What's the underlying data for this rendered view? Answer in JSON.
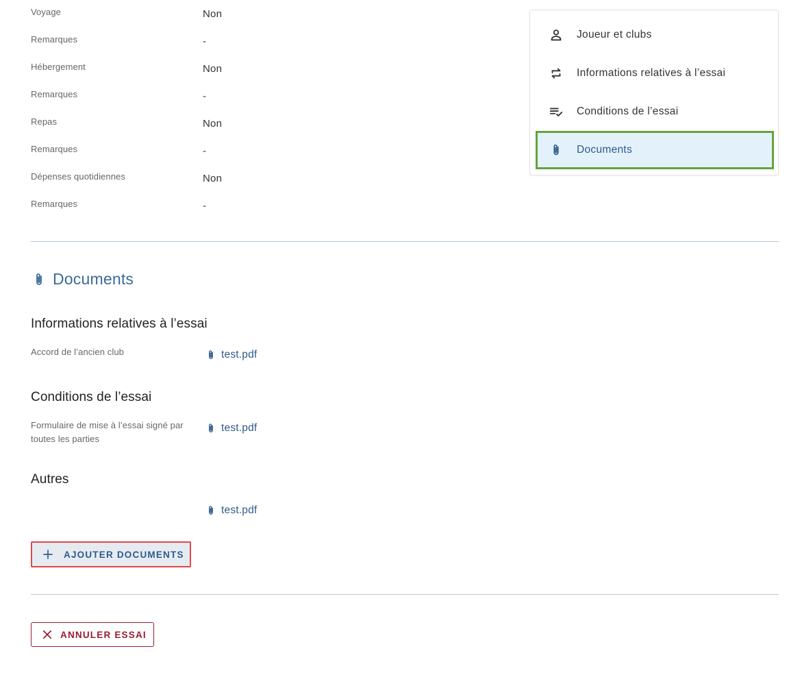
{
  "details": [
    {
      "label": "Voyage",
      "value": "Non"
    },
    {
      "label": "Remarques",
      "value": "-"
    },
    {
      "label": "Hébergement",
      "value": "Non"
    },
    {
      "label": "Remarques",
      "value": "-"
    },
    {
      "label": "Repas",
      "value": "Non"
    },
    {
      "label": "Remarques",
      "value": "-"
    },
    {
      "label": "Dépenses quotidiennes",
      "value": "Non"
    },
    {
      "label": "Remarques",
      "value": "-"
    }
  ],
  "nav": {
    "items": [
      {
        "label": "Joueur et clubs",
        "icon": "person-icon"
      },
      {
        "label": "Informations relatives à l’essai",
        "icon": "swap-icon"
      },
      {
        "label": "Conditions de l’essai",
        "icon": "checklist-icon"
      },
      {
        "label": "Documents",
        "icon": "paperclip-icon",
        "active": true
      }
    ]
  },
  "documents": {
    "title": "Documents",
    "groups": [
      {
        "heading": "Informations relatives à l’essai",
        "label": "Accord de l’ancien club",
        "file": "test.pdf"
      },
      {
        "heading": "Conditions de l’essai",
        "label": "Formulaire de mise à l’essai signé par toutes les parties",
        "file": "test.pdf"
      },
      {
        "heading": "Autres",
        "label": "",
        "file": "test.pdf"
      }
    ],
    "add_button_label": "AJOUTER DOCUMENTS"
  },
  "cancel_button_label": "ANNULER ESSAI",
  "colors": {
    "accent": "#2f5a8a",
    "active_bg": "#e3f2fa",
    "active_outline": "#65a33a",
    "danger": "#9b1b30",
    "highlight_red": "#e04646",
    "divider": "#b5c6d6"
  }
}
